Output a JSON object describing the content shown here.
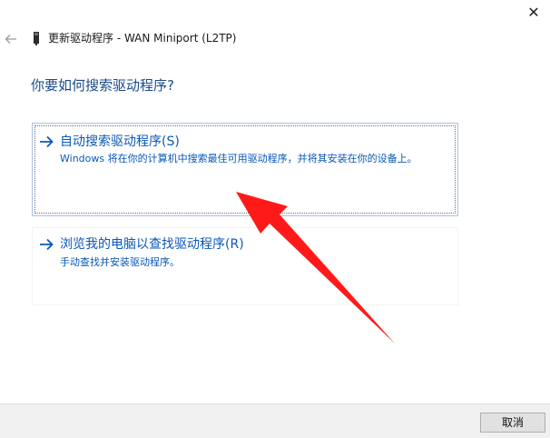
{
  "window": {
    "close_glyph": "✕"
  },
  "header": {
    "title": "更新驱动程序 - WAN Miniport (L2TP)"
  },
  "question": "你要如何搜索驱动程序?",
  "options": [
    {
      "title": "自动搜索驱动程序(S)",
      "description": "Windows 将在你的计算机中搜索最佳可用驱动程序，并将其安装在你的设备上。",
      "selected": true
    },
    {
      "title": "浏览我的电脑以查找驱动程序(R)",
      "description": "手动查找并安装驱动程序。",
      "selected": false
    }
  ],
  "footer": {
    "cancel_label": "取消"
  },
  "colors": {
    "accent": "#0a58b8",
    "annotation": "#ff1a1a"
  },
  "icons": {
    "back": "arrow-left-icon",
    "device": "device-icon",
    "option_arrow": "arrow-right-icon"
  }
}
